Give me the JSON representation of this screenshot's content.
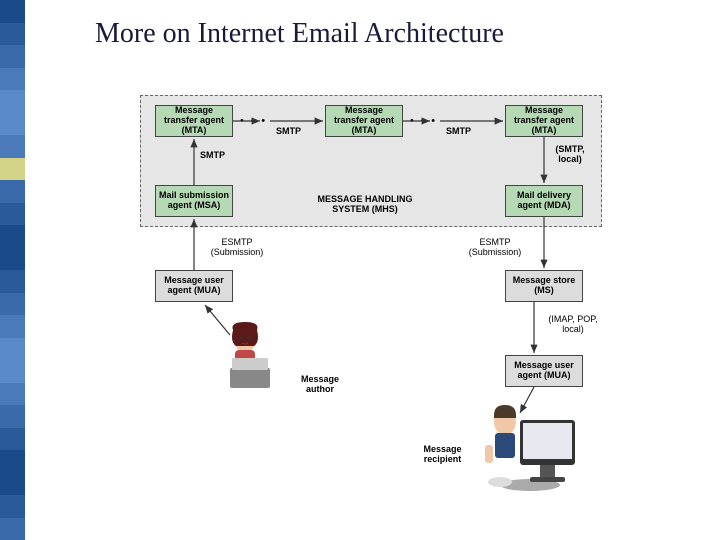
{
  "title": "More on Internet Email Architecture",
  "sidebar_colors": [
    "#1a4a8a",
    "#2a5a9a",
    "#3a6aaa",
    "#4a7aba",
    "#5a8aca",
    "#5a8aca",
    "#4a7aba",
    "#d4d488",
    "#3a6aaa",
    "#2a5a9a",
    "#1a4a8a",
    "#1a4a8a",
    "#2a5a9a",
    "#3a6aaa",
    "#4a7aba",
    "#5a8aca",
    "#5a8aca",
    "#4a7aba",
    "#3a6aaa",
    "#2a5a9a",
    "#1a4a8a",
    "#1a4a8a",
    "#2a5a9a",
    "#3a6aaa"
  ],
  "mhs": {
    "label": "MESSAGE HANDLING SYSTEM (MHS)"
  },
  "nodes": {
    "mta1": "Message transfer agent (MTA)",
    "mta2": "Message transfer agent (MTA)",
    "mta3": "Message transfer agent (MTA)",
    "msa": "Mail submission agent (MSA)",
    "mda": "Mail delivery agent (MDA)",
    "mua1": "Message user agent (MUA)",
    "ms": "Message store (MS)",
    "mua2": "Message user agent (MUA)"
  },
  "labels": {
    "smtp1": "SMTP",
    "smtp2": "SMTP",
    "smtp_vert": "SMTP",
    "smtp_local": "(SMTP, local)",
    "esmtp_left": "ESMTP (Submission)",
    "esmtp_right": "ESMTP (Submission)",
    "imap": "(IMAP, POP, local)",
    "author": "Message author",
    "recipient": "Message recipient"
  },
  "dots": "• • •"
}
